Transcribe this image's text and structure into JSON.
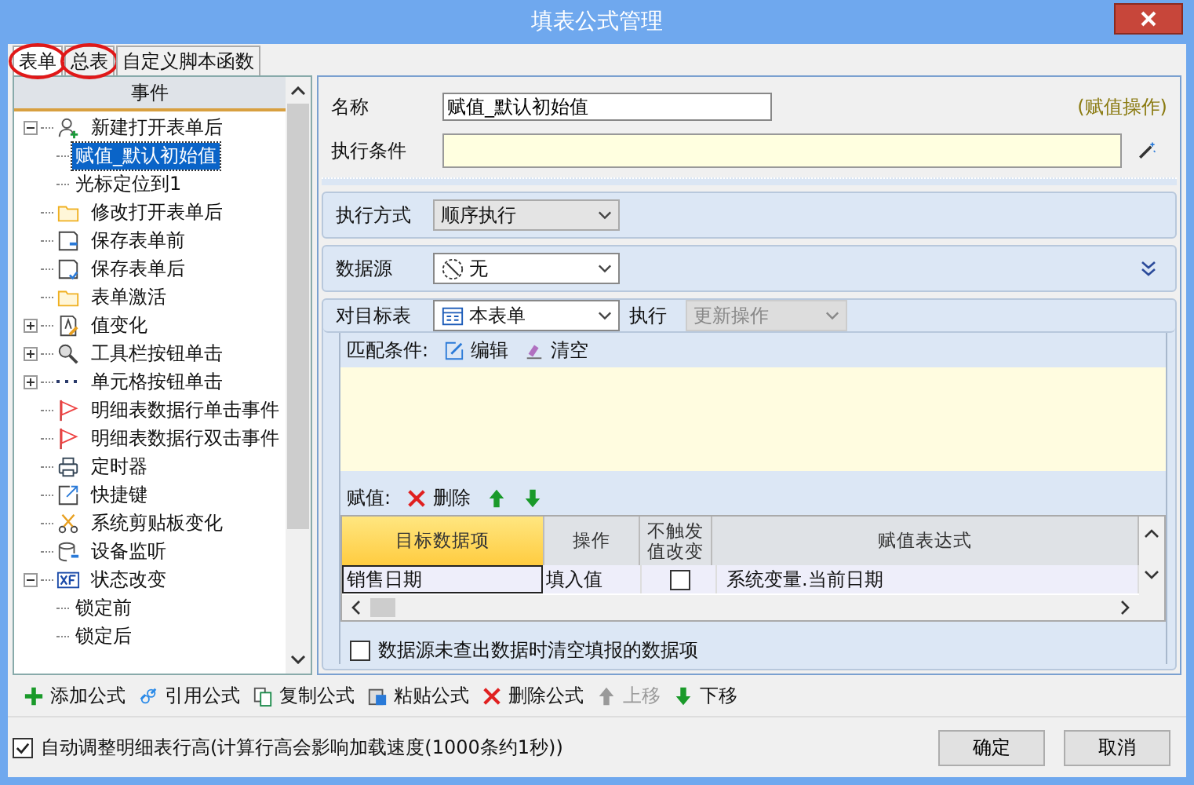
{
  "window": {
    "title": "填表公式管理"
  },
  "tabs": [
    {
      "label": "表单",
      "selected": true,
      "circled": true
    },
    {
      "label": "总表",
      "selected": false,
      "circled": true
    },
    {
      "label": "自定义脚本函数",
      "selected": false,
      "circled": false
    }
  ],
  "tree": {
    "header": "事件",
    "items": [
      {
        "label": "新建打开表单后",
        "kind": "user-add",
        "expanded": true,
        "selected": false,
        "children": [
          {
            "label": "赋值_默认初始值",
            "selected": true
          },
          {
            "label": "光标定位到1",
            "selected": false
          }
        ]
      },
      {
        "label": "修改打开表单后",
        "kind": "folder",
        "selected": false
      },
      {
        "label": "保存表单前",
        "kind": "save-before",
        "selected": false
      },
      {
        "label": "保存表单后",
        "kind": "save-after",
        "selected": false
      },
      {
        "label": "表单激活",
        "kind": "folder",
        "selected": false
      },
      {
        "label": "值变化",
        "kind": "value-change",
        "expanded": false,
        "selected": false
      },
      {
        "label": "工具栏按钮单击",
        "kind": "tool",
        "expanded": false,
        "selected": false
      },
      {
        "label": "单元格按钮单击",
        "kind": "dots",
        "expanded": false,
        "selected": false
      },
      {
        "label": "明细表数据行单击事件",
        "kind": "flag",
        "selected": false
      },
      {
        "label": "明细表数据行双击事件",
        "kind": "flag",
        "selected": false
      },
      {
        "label": "定时器",
        "kind": "printer",
        "selected": false
      },
      {
        "label": "快捷键",
        "kind": "shortcut",
        "selected": false
      },
      {
        "label": "系统剪贴板变化",
        "kind": "scissors",
        "selected": false
      },
      {
        "label": "设备监听",
        "kind": "device",
        "selected": false
      },
      {
        "label": "状态改变",
        "kind": "state",
        "expanded": true,
        "selected": false,
        "children": [
          {
            "label": "锁定前",
            "selected": false
          },
          {
            "label": "锁定后",
            "selected": false
          }
        ]
      }
    ]
  },
  "form": {
    "name_label": "名称",
    "name_value": "赋值_默认初始值",
    "type_note": "(赋值操作)",
    "condition_label": "执行条件",
    "mode_label": "执行方式",
    "mode_value": "顺序执行",
    "source_label": "数据源",
    "source_value": "无",
    "target_label": "对目标表",
    "target_value": "本表单",
    "exec_label": "执行",
    "exec_value": "更新操作",
    "exec_disabled": true,
    "match_label": "匹配条件:",
    "match_edit": "编辑",
    "match_clear": "清空",
    "assign_label": "赋值:",
    "assign_delete": "删除"
  },
  "grid": {
    "columns": [
      {
        "label": "目标数据项",
        "selected": true
      },
      {
        "label": "操作",
        "selected": false
      },
      {
        "label": "不触发值改变",
        "selected": false
      },
      {
        "label": "赋值表达式",
        "selected": false
      }
    ],
    "rows": [
      {
        "target": "销售日期",
        "operation": "填入值",
        "no_trigger": false,
        "expression": "系统变量.当前日期"
      }
    ]
  },
  "clear_option": {
    "label": "数据源未查出数据时清空填报的数据项",
    "checked": false
  },
  "toolbar": [
    {
      "label": "添加公式",
      "kind": "plus",
      "disabled": false
    },
    {
      "label": "引用公式",
      "kind": "link",
      "disabled": false
    },
    {
      "label": "复制公式",
      "kind": "copy",
      "disabled": false
    },
    {
      "label": "粘贴公式",
      "kind": "paste",
      "disabled": false
    },
    {
      "label": "删除公式",
      "kind": "delete",
      "disabled": false
    },
    {
      "label": "上移",
      "kind": "up",
      "disabled": true
    },
    {
      "label": "下移",
      "kind": "down",
      "disabled": false
    }
  ],
  "auto_height": {
    "label": "自动调整明细表行高(计算行高会影响加载速度(1000条约1秒))",
    "checked": true
  },
  "buttons": [
    "确定",
    "取消"
  ]
}
